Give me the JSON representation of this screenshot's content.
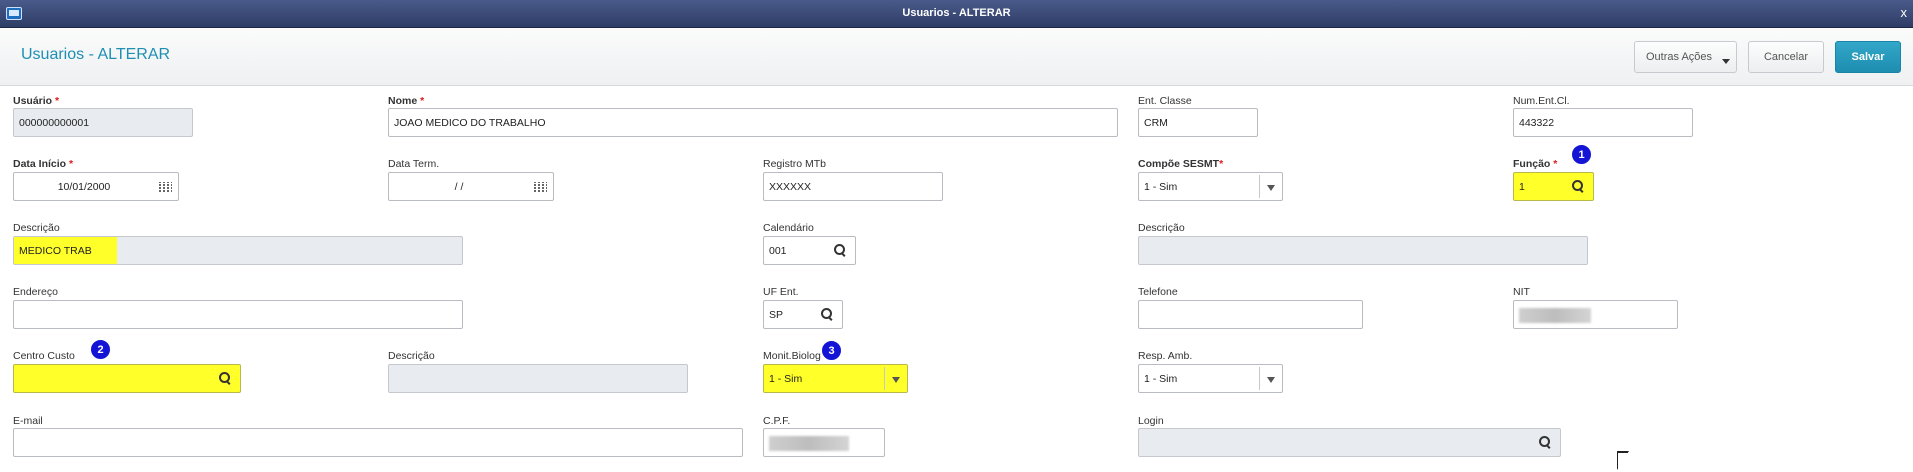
{
  "window": {
    "title": "Usuarios - ALTERAR",
    "close_glyph": "x"
  },
  "header": {
    "title": "Usuarios - ALTERAR",
    "buttons": {
      "outras_acoes": "Outras Ações",
      "cancelar": "Cancelar",
      "salvar": "Salvar"
    }
  },
  "form": {
    "usuario": {
      "label": "Usuário",
      "value": "000000000001"
    },
    "nome": {
      "label": "Nome",
      "value": "JOAO MEDICO DO TRABALHO"
    },
    "ent_classe": {
      "label": "Ent. Classe",
      "value": "CRM"
    },
    "num_ent_cl": {
      "label": "Num.Ent.Cl.",
      "value": "443322"
    },
    "data_inicio": {
      "label": "Data Início",
      "value": "10/01/2000"
    },
    "data_term": {
      "label": "Data Term.",
      "value": "/  /"
    },
    "registro_mtb": {
      "label": "Registro MTb",
      "value": "XXXXXX"
    },
    "compoe_sesmt": {
      "label": "Compõe SESMT",
      "value": "1 - Sim"
    },
    "funcao": {
      "label": "Função",
      "value": "1"
    },
    "descricao_funcao": {
      "label": "Descrição",
      "value": "MEDICO TRAB"
    },
    "calendario": {
      "label": "Calendário",
      "value": "001"
    },
    "descricao_calendario": {
      "label": "Descrição",
      "value": ""
    },
    "endereco": {
      "label": "Endereço",
      "value": ""
    },
    "uf_ent": {
      "label": "UF Ent.",
      "value": "SP"
    },
    "telefone": {
      "label": "Telefone",
      "value": ""
    },
    "nit": {
      "label": "NIT",
      "value": ""
    },
    "centro_custo": {
      "label": "Centro Custo",
      "value": ""
    },
    "descricao_cc": {
      "label": "Descrição",
      "value": ""
    },
    "monit_biolog": {
      "label": "Monit.Biolog",
      "value": "1 - Sim"
    },
    "resp_amb": {
      "label": "Resp. Amb.",
      "value": "1 - Sim"
    },
    "email": {
      "label": "E-mail",
      "value": ""
    },
    "cpf": {
      "label": "C.P.F.",
      "value": ""
    },
    "login": {
      "label": "Login",
      "value": ""
    }
  },
  "badges": [
    "1",
    "2",
    "3"
  ],
  "colors": {
    "highlight": "#ffff2a",
    "badge": "#1414d6",
    "accent": "#1e8fb3",
    "save": "#1d8db0"
  }
}
